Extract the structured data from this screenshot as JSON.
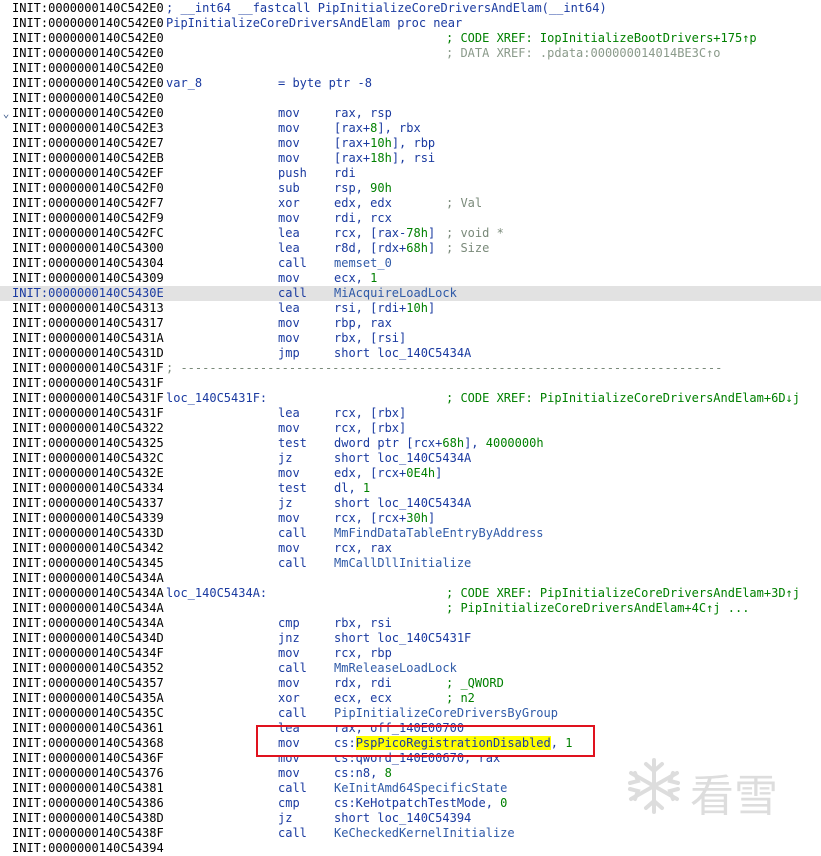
{
  "colors": {
    "highlight_row": "#e2e2e2",
    "search_highlight": "#ffff00",
    "annotation_box": "#e0121e"
  },
  "gutter": {
    "icon": "chevron-down-icon",
    "glyph": "⌄"
  },
  "watermark": {
    "text": "看雪",
    "icon": "snowflake-icon"
  },
  "lines": [
    {
      "addr": "INIT:0000000140C542E0",
      "label": "; __int64 __fastcall PipInitializeCoreDriversAndElam(__int64)"
    },
    {
      "addr": "INIT:0000000140C542E0",
      "label": "PipInitializeCoreDriversAndElam proc near"
    },
    {
      "addr": "INIT:0000000140C542E0",
      "comment": "; CODE XREF: IopInitializeBootDrivers+175↑p",
      "ckind": "code"
    },
    {
      "addr": "INIT:0000000140C542E0",
      "comment": "; DATA XREF: .pdata:000000014014BE3C↑o",
      "ckind": "data"
    },
    {
      "addr": "INIT:0000000140C542E0"
    },
    {
      "addr": "INIT:0000000140C542E0",
      "label": "var_8",
      "mnem": "= byte ptr -8"
    },
    {
      "addr": "INIT:0000000140C542E0"
    },
    {
      "addr": "INIT:0000000140C542E0",
      "gutter": true,
      "mnem": "mov",
      "ops": [
        {
          "t": "rax, rsp"
        }
      ]
    },
    {
      "addr": "INIT:0000000140C542E3",
      "mnem": "mov",
      "ops": [
        {
          "t": "[rax+"
        },
        {
          "t": "8",
          "k": "n"
        },
        {
          "t": "], rbx"
        }
      ]
    },
    {
      "addr": "INIT:0000000140C542E7",
      "mnem": "mov",
      "ops": [
        {
          "t": "[rax+"
        },
        {
          "t": "10h",
          "k": "n"
        },
        {
          "t": "], rbp"
        }
      ]
    },
    {
      "addr": "INIT:0000000140C542EB",
      "mnem": "mov",
      "ops": [
        {
          "t": "[rax+"
        },
        {
          "t": "18h",
          "k": "n"
        },
        {
          "t": "], rsi"
        }
      ]
    },
    {
      "addr": "INIT:0000000140C542EF",
      "mnem": "push",
      "ops": [
        {
          "t": "rdi"
        }
      ]
    },
    {
      "addr": "INIT:0000000140C542F0",
      "mnem": "sub",
      "ops": [
        {
          "t": "rsp, "
        },
        {
          "t": "90h",
          "k": "n"
        }
      ]
    },
    {
      "addr": "INIT:0000000140C542F7",
      "mnem": "xor",
      "ops": [
        {
          "t": "edx, edx"
        }
      ],
      "comment": "; Val"
    },
    {
      "addr": "INIT:0000000140C542F9",
      "mnem": "mov",
      "ops": [
        {
          "t": "rdi, rcx"
        }
      ]
    },
    {
      "addr": "INIT:0000000140C542FC",
      "mnem": "lea",
      "ops": [
        {
          "t": "rcx, [rax-"
        },
        {
          "t": "78h",
          "k": "n"
        },
        {
          "t": "]"
        }
      ],
      "comment": "; void *"
    },
    {
      "addr": "INIT:0000000140C54300",
      "mnem": "lea",
      "ops": [
        {
          "t": "r8d, [rdx+"
        },
        {
          "t": "68h",
          "k": "n"
        },
        {
          "t": "]"
        }
      ],
      "comment": "; Size"
    },
    {
      "addr": "INIT:0000000140C54304",
      "mnem": "call",
      "ops": [
        {
          "t": "memset_0",
          "k": "fn"
        }
      ]
    },
    {
      "addr": "INIT:0000000140C54309",
      "mnem": "mov",
      "ops": [
        {
          "t": "ecx, "
        },
        {
          "t": "1",
          "k": "n"
        }
      ]
    },
    {
      "addr": "INIT:0000000140C5430E",
      "hl": true,
      "mnem": "call",
      "ops": [
        {
          "t": "MiAcquireLoadLock",
          "k": "fn"
        }
      ]
    },
    {
      "addr": "INIT:0000000140C54313",
      "mnem": "lea",
      "ops": [
        {
          "t": "rsi, [rdi+"
        },
        {
          "t": "10h",
          "k": "n"
        },
        {
          "t": "]"
        }
      ]
    },
    {
      "addr": "INIT:0000000140C54317",
      "mnem": "mov",
      "ops": [
        {
          "t": "rbp, rax"
        }
      ]
    },
    {
      "addr": "INIT:0000000140C5431A",
      "mnem": "mov",
      "ops": [
        {
          "t": "rbx, [rsi]"
        }
      ]
    },
    {
      "addr": "INIT:0000000140C5431D",
      "mnem": "jmp",
      "ops": [
        {
          "t": "short loc_140C5434A"
        }
      ]
    },
    {
      "addr": "INIT:0000000140C5431F",
      "label": "; ---------------------------------------------------------------------------",
      "sep": true
    },
    {
      "addr": "INIT:0000000140C5431F"
    },
    {
      "addr": "INIT:0000000140C5431F",
      "label": "loc_140C5431F:",
      "comment": "; CODE XREF: PipInitializeCoreDriversAndElam+6D↓j",
      "ckind": "code"
    },
    {
      "addr": "INIT:0000000140C5431F",
      "mnem": "lea",
      "ops": [
        {
          "t": "rcx, [rbx]"
        }
      ]
    },
    {
      "addr": "INIT:0000000140C54322",
      "mnem": "mov",
      "ops": [
        {
          "t": "rcx, [rbx]"
        }
      ]
    },
    {
      "addr": "INIT:0000000140C54325",
      "mnem": "test",
      "ops": [
        {
          "t": "dword ptr [rcx+"
        },
        {
          "t": "68h",
          "k": "n"
        },
        {
          "t": "], "
        },
        {
          "t": "4000000h",
          "k": "n"
        }
      ]
    },
    {
      "addr": "INIT:0000000140C5432C",
      "mnem": "jz",
      "ops": [
        {
          "t": "short loc_140C5434A"
        }
      ]
    },
    {
      "addr": "INIT:0000000140C5432E",
      "mnem": "mov",
      "ops": [
        {
          "t": "edx, [rcx+"
        },
        {
          "t": "0E4h",
          "k": "n"
        },
        {
          "t": "]"
        }
      ]
    },
    {
      "addr": "INIT:0000000140C54334",
      "mnem": "test",
      "ops": [
        {
          "t": "dl, "
        },
        {
          "t": "1",
          "k": "n"
        }
      ]
    },
    {
      "addr": "INIT:0000000140C54337",
      "mnem": "jz",
      "ops": [
        {
          "t": "short loc_140C5434A"
        }
      ]
    },
    {
      "addr": "INIT:0000000140C54339",
      "mnem": "mov",
      "ops": [
        {
          "t": "rcx, [rcx+"
        },
        {
          "t": "30h",
          "k": "n"
        },
        {
          "t": "]"
        }
      ]
    },
    {
      "addr": "INIT:0000000140C5433D",
      "mnem": "call",
      "ops": [
        {
          "t": "MmFindDataTableEntryByAddress",
          "k": "fn"
        }
      ]
    },
    {
      "addr": "INIT:0000000140C54342",
      "mnem": "mov",
      "ops": [
        {
          "t": "rcx, rax"
        }
      ]
    },
    {
      "addr": "INIT:0000000140C54345",
      "mnem": "call",
      "ops": [
        {
          "t": "MmCallDllInitialize",
          "k": "fn"
        }
      ]
    },
    {
      "addr": "INIT:0000000140C5434A"
    },
    {
      "addr": "INIT:0000000140C5434A",
      "label": "loc_140C5434A:",
      "comment": "; CODE XREF: PipInitializeCoreDriversAndElam+3D↑j",
      "ckind": "code"
    },
    {
      "addr": "INIT:0000000140C5434A",
      "comment": "; PipInitializeCoreDriversAndElam+4C↑j ...",
      "ckind": "code"
    },
    {
      "addr": "INIT:0000000140C5434A",
      "mnem": "cmp",
      "ops": [
        {
          "t": "rbx, rsi"
        }
      ]
    },
    {
      "addr": "INIT:0000000140C5434D",
      "mnem": "jnz",
      "ops": [
        {
          "t": "short loc_140C5431F"
        }
      ]
    },
    {
      "addr": "INIT:0000000140C5434F",
      "mnem": "mov",
      "ops": [
        {
          "t": "rcx, rbp"
        }
      ]
    },
    {
      "addr": "INIT:0000000140C54352",
      "mnem": "call",
      "ops": [
        {
          "t": "MmReleaseLoadLock",
          "k": "fn"
        }
      ]
    },
    {
      "addr": "INIT:0000000140C54357",
      "mnem": "mov",
      "ops": [
        {
          "t": "rdx, rdi"
        }
      ],
      "comment": "; _QWORD",
      "ckind": "code"
    },
    {
      "addr": "INIT:0000000140C5435A",
      "mnem": "xor",
      "ops": [
        {
          "t": "ecx, ecx"
        }
      ],
      "comment": "; n2",
      "ckind": "code"
    },
    {
      "addr": "INIT:0000000140C5435C",
      "mnem": "call",
      "ops": [
        {
          "t": "PipInitializeCoreDriversByGroup",
          "k": "fn"
        }
      ]
    },
    {
      "addr": "INIT:0000000140C54361",
      "mnem": "lea",
      "ops": [
        {
          "t": "rax, off_140E00700"
        }
      ]
    },
    {
      "addr": "INIT:0000000140C54368",
      "mnem": "mov",
      "ops": [
        {
          "t": "cs:"
        },
        {
          "t": "PspPicoRegistrationDisabled",
          "k": "hlw"
        },
        {
          "t": ", "
        },
        {
          "t": "1",
          "k": "n"
        }
      ]
    },
    {
      "addr": "INIT:0000000140C5436F",
      "mnem": "mov",
      "ops": [
        {
          "t": "cs:qword_140E00670, rax"
        }
      ]
    },
    {
      "addr": "INIT:0000000140C54376",
      "mnem": "mov",
      "ops": [
        {
          "t": "cs:n8, "
        },
        {
          "t": "8",
          "k": "n"
        }
      ]
    },
    {
      "addr": "INIT:0000000140C54381",
      "mnem": "call",
      "ops": [
        {
          "t": "KeInitAmd64SpecificState",
          "k": "fn"
        }
      ]
    },
    {
      "addr": "INIT:0000000140C54386",
      "mnem": "cmp",
      "ops": [
        {
          "t": "cs:KeHotpatchTestMode, "
        },
        {
          "t": "0",
          "k": "n"
        }
      ]
    },
    {
      "addr": "INIT:0000000140C5438D",
      "mnem": "jz",
      "ops": [
        {
          "t": "short loc_140C54394"
        }
      ]
    },
    {
      "addr": "INIT:0000000140C5438F",
      "mnem": "call",
      "ops": [
        {
          "t": "KeCheckedKernelInitialize",
          "k": "fn"
        }
      ]
    },
    {
      "addr": "INIT:0000000140C54394"
    }
  ]
}
